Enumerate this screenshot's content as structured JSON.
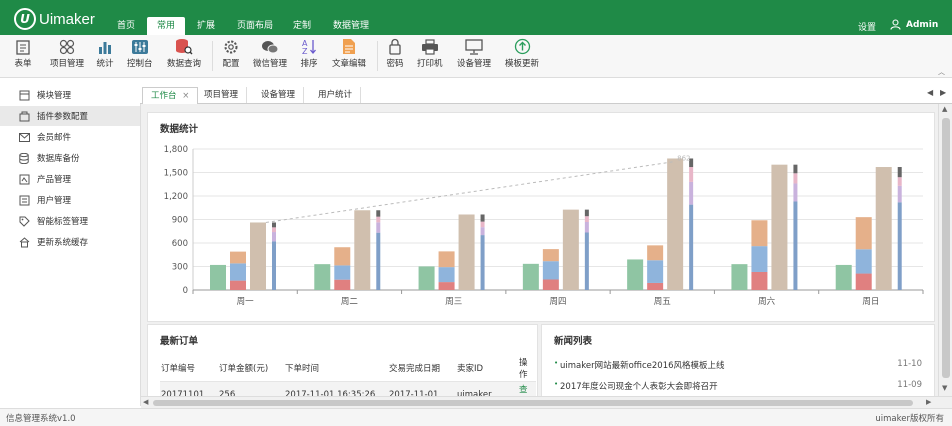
{
  "app": {
    "logo_text": "Uimaker",
    "logo_mark": "U"
  },
  "topnav": {
    "tabs": [
      "首页",
      "常用",
      "扩展",
      "页面布局",
      "定制",
      "数据管理"
    ],
    "active": 1,
    "settings": "设置",
    "user": "Admin"
  },
  "toolbar": {
    "items": [
      {
        "label": "表单",
        "icon": "form-icon"
      },
      {
        "label": "项目管理",
        "icon": "grid-icon"
      },
      {
        "label": "统计",
        "icon": "bar-chart-icon"
      },
      {
        "label": "控制台",
        "icon": "sliders-icon"
      },
      {
        "label": "数据查询",
        "icon": "database-search-icon"
      },
      {
        "label": "配置",
        "icon": "gear-icon"
      },
      {
        "label": "微信管理",
        "icon": "wechat-icon"
      },
      {
        "label": "排序",
        "icon": "sort-az-icon"
      },
      {
        "label": "文章编辑",
        "icon": "document-edit-icon"
      },
      {
        "label": "密码",
        "icon": "lock-icon"
      },
      {
        "label": "打印机",
        "icon": "printer-icon"
      },
      {
        "label": "设备管理",
        "icon": "monitor-icon"
      },
      {
        "label": "模板更新",
        "icon": "upload-circle-icon"
      }
    ]
  },
  "sidebar": {
    "items": [
      {
        "label": "模块管理",
        "icon": "module-icon"
      },
      {
        "label": "插件参数配置",
        "icon": "plugin-icon"
      },
      {
        "label": "会员邮件",
        "icon": "mail-icon"
      },
      {
        "label": "数据库备份",
        "icon": "database-icon"
      },
      {
        "label": "产品管理",
        "icon": "product-icon"
      },
      {
        "label": "用户管理",
        "icon": "user-manage-icon"
      },
      {
        "label": "智能标签管理",
        "icon": "tag-icon"
      },
      {
        "label": "更新系统缓存",
        "icon": "home-cache-icon"
      }
    ],
    "active": 1
  },
  "content_tabs": {
    "tabs": [
      "工作台",
      "项目管理",
      "设备管理",
      "用户统计"
    ],
    "active": 0
  },
  "stats_panel": {
    "title": "数据统计"
  },
  "chart_data": {
    "type": "bar",
    "categories": [
      "周一",
      "周二",
      "周三",
      "周四",
      "周五",
      "周六",
      "周日"
    ],
    "ylim": [
      0,
      1800
    ],
    "yticks": [
      0,
      300,
      600,
      900,
      1200,
      1500,
      1800
    ],
    "ytick_labels": [
      "0",
      "300",
      "600",
      "900",
      "1,200",
      "1,500",
      "1,800"
    ],
    "grid": true,
    "series_colors": {
      "green": "#8fc5a3",
      "red": "#e08080",
      "blue": "#8fb4dc",
      "orange": "#e5b08a",
      "tan": "#d0bfae",
      "steel": "#7f9fc8",
      "purple": "#c9b2dd",
      "pink": "#e8b6c8",
      "gray": "#666666"
    },
    "single": [
      320,
      330,
      301,
      334,
      390,
      330,
      320
    ],
    "stack_red": [
      120,
      132,
      101,
      134,
      90,
      230,
      210
    ],
    "stack_blue": [
      220,
      182,
      191,
      234,
      290,
      330,
      310
    ],
    "stack_orange": [
      150,
      232,
      201,
      154,
      190,
      330,
      410
    ],
    "total": [
      862,
      1018,
      964,
      1026,
      1679,
      1600,
      1570
    ],
    "thin_base": [
      620,
      732,
      701,
      734,
      1090,
      1130,
      1120
    ],
    "thin_purple": [
      120,
      132,
      101,
      134,
      290,
      230,
      210
    ],
    "thin_pink": [
      60,
      72,
      71,
      74,
      190,
      130,
      110
    ],
    "thin_gray": [
      62,
      82,
      91,
      84,
      109,
      110,
      130
    ],
    "markline": {
      "from_index": 0,
      "to_index": 4,
      "label": "862"
    }
  },
  "orders": {
    "title": "最新订单",
    "columns": [
      "订单编号",
      "订单金额(元)",
      "下单时间",
      "交易完成日期",
      "卖家ID",
      "操作"
    ],
    "rows": [
      [
        "20171101",
        "256",
        "2017-11-01 16:35:26",
        "2017-11-01",
        "uimaker",
        "查看"
      ]
    ]
  },
  "news": {
    "title": "新闻列表",
    "items": [
      {
        "text": "uimaker网站最新office2016风格模板上线",
        "date": "11-10"
      },
      {
        "text": "2017年度公司现金个人表彰大会即将召开",
        "date": "11-09"
      }
    ]
  },
  "footer": {
    "left": "信息管理系统v1.0",
    "right": "uimaker版权所有"
  }
}
